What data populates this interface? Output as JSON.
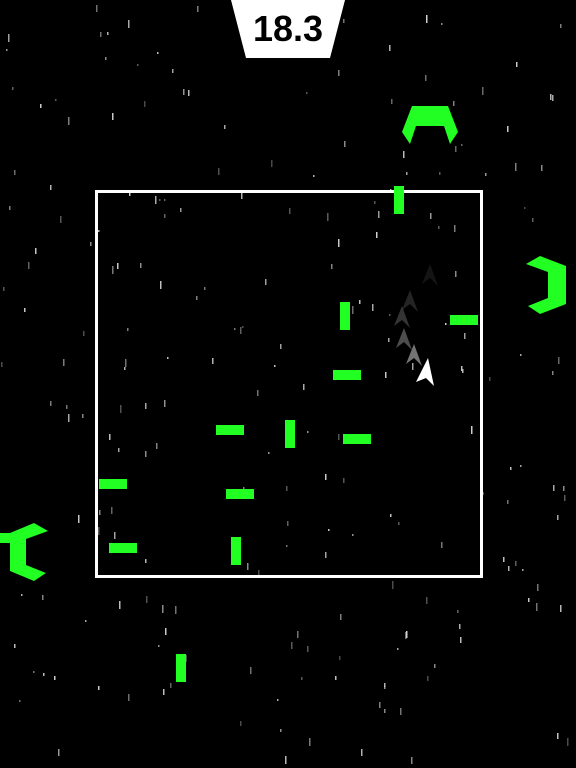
{
  "hud": {
    "timer": "18.3"
  },
  "colors": {
    "background": "#000000",
    "arena_border": "#ffffff",
    "bullet": "#22ff22",
    "enemy": "#22ff22",
    "player": "#ffffff",
    "star": "#d0d0d0",
    "timer_bg": "#ffffff",
    "timer_text": "#000000"
  },
  "icons": {
    "player": "arrowhead-ship-icon",
    "enemy": "claw-turret-icon"
  }
}
